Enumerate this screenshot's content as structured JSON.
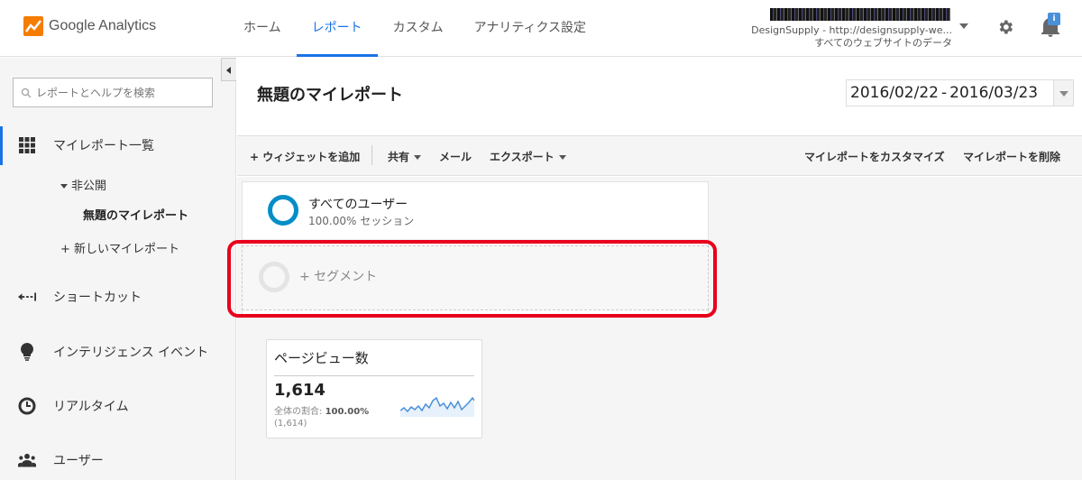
{
  "app": {
    "brand": "Google Analytics"
  },
  "nav": {
    "tabs": [
      {
        "label": "ホーム"
      },
      {
        "label": "レポート"
      },
      {
        "label": "カスタム"
      },
      {
        "label": "アナリティクス設定"
      }
    ],
    "active_tab": "レポート"
  },
  "account": {
    "property_line": "DesignSupply - http://designsupply-we...",
    "view_line": "すべてのウェブサイトのデータ"
  },
  "notifications": {
    "badge": "i"
  },
  "sidebar": {
    "search_placeholder": "レポートとヘルプを検索",
    "items": [
      {
        "label": "マイレポート一覧",
        "icon": "grid-icon"
      },
      {
        "label": "ショートカット",
        "icon": "shortcut-icon"
      },
      {
        "label": "インテリジェンス イベント",
        "icon": "lightbulb-icon"
      },
      {
        "label": "リアルタイム",
        "icon": "clock-icon"
      },
      {
        "label": "ユーザー",
        "icon": "users-icon"
      }
    ],
    "sub": {
      "private_label": "非公開",
      "current_report": "無題のマイレポート",
      "new_report": "+ 新しいマイレポート"
    }
  },
  "main": {
    "title": "無題のマイレポート",
    "date_start": "2016/02/22",
    "date_sep": "-",
    "date_end": "2016/03/23",
    "toolbar": {
      "add_widget": "+ ウィジェットを追加",
      "share": "共有",
      "email": "メール",
      "export": "エクスポート",
      "customize": "マイレポートをカスタマイズ",
      "delete": "マイレポートを削除"
    },
    "segments": {
      "all_users_name": "すべてのユーザー",
      "all_users_sub": "100.00% セッション",
      "add_segment": "+ セグメント"
    },
    "widget": {
      "title": "ページビュー数",
      "value": "1,614",
      "pct_label": "全体の割合:",
      "pct_value": "100.00%",
      "total": "(1,614)",
      "sparkline_color": "#4a90d9"
    }
  },
  "colors": {
    "accent": "#1a73e8",
    "segment_ring": "#058dc7",
    "highlight": "#e8001c"
  }
}
